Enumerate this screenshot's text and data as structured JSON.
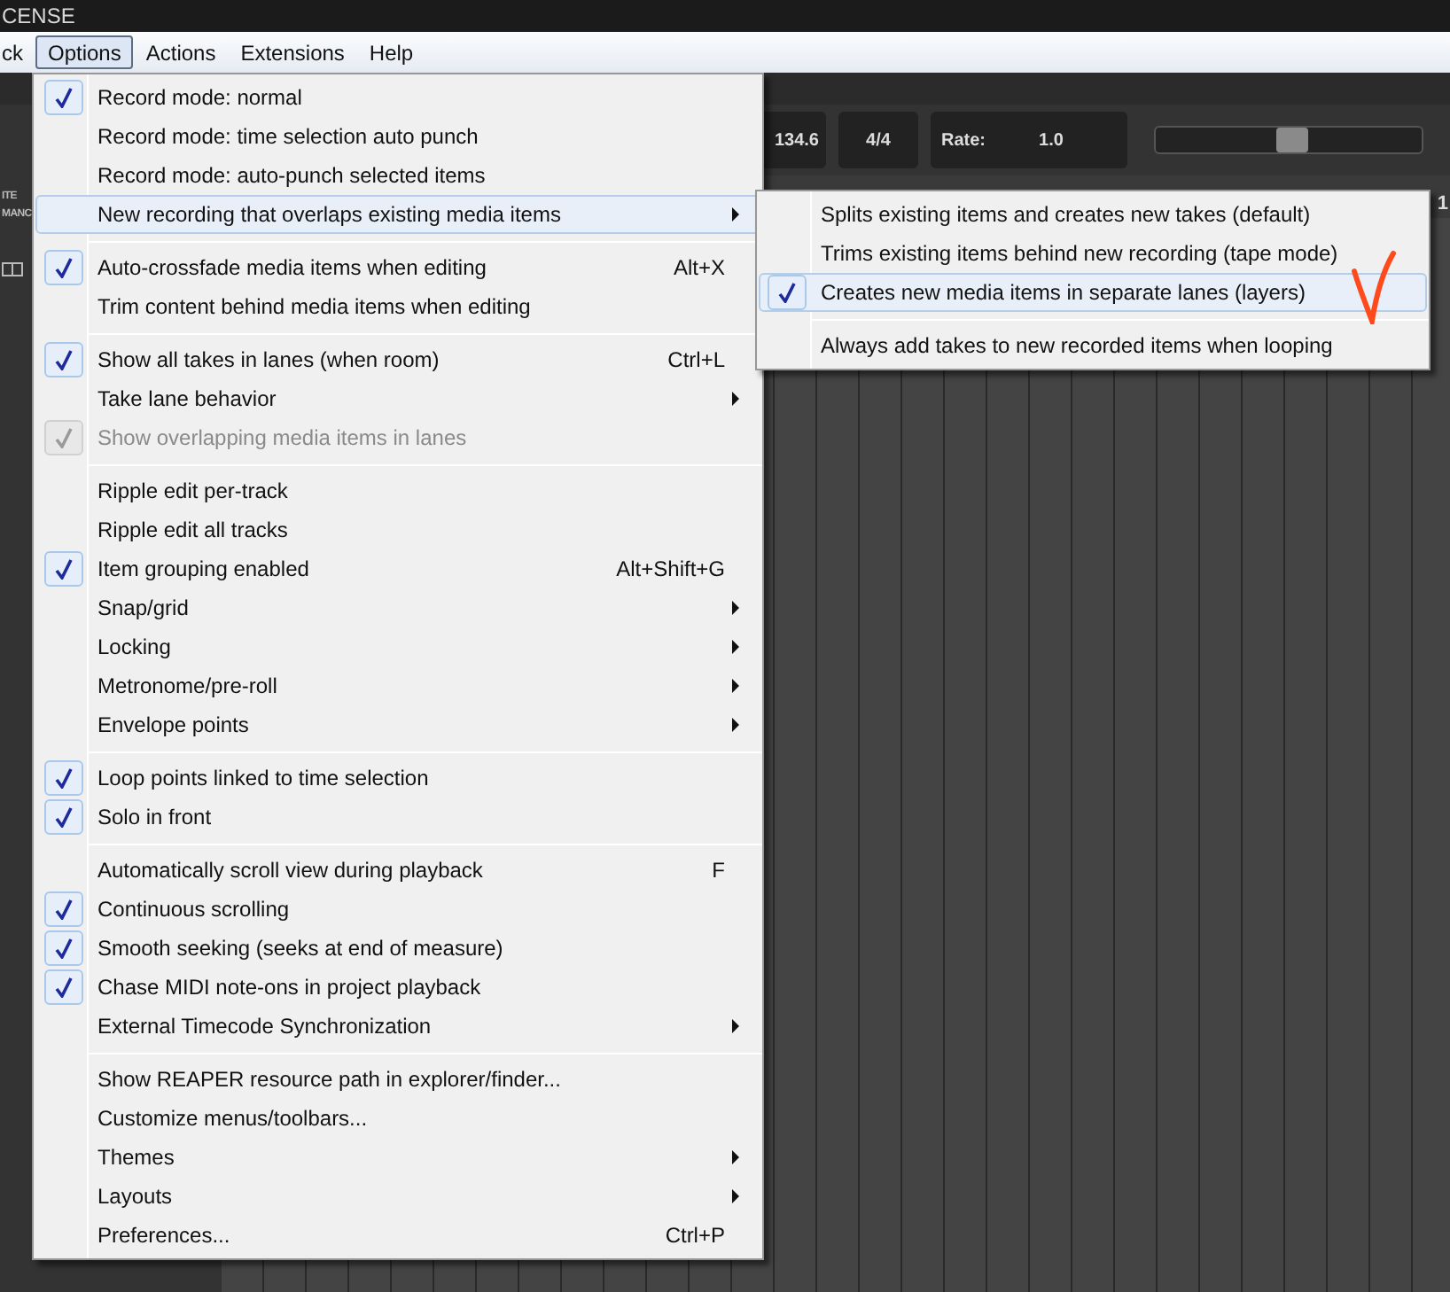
{
  "title_bar": {
    "title": "CENSE"
  },
  "menu_bar": [
    {
      "label": "ck",
      "selected": false
    },
    {
      "label": "Options",
      "selected": true
    },
    {
      "label": "Actions",
      "selected": false
    },
    {
      "label": "Extensions",
      "selected": false
    },
    {
      "label": "Help",
      "selected": false
    }
  ],
  "toolbar": {
    "tempo": "134.6",
    "time_signature": "4/4",
    "rate_label": "Rate:",
    "rate_value": "1.0",
    "playrate_slider": {
      "level": 0.51
    }
  },
  "track_panel": {
    "header_lines": [
      "ITE",
      "MANC"
    ]
  },
  "ruler": {
    "marker": "1"
  },
  "options_menu": [
    {
      "kind": "item",
      "label": "Record mode: normal",
      "checked": true,
      "disabled": false,
      "selected": false,
      "has_submenu": false
    },
    {
      "kind": "item",
      "label": "Record mode: time selection auto punch",
      "checked": false,
      "disabled": false,
      "selected": false,
      "has_submenu": false
    },
    {
      "kind": "item",
      "label": "Record mode: auto-punch selected items",
      "checked": false,
      "disabled": false,
      "selected": false,
      "has_submenu": false
    },
    {
      "kind": "item",
      "label": "New recording that overlaps existing media items",
      "checked": false,
      "disabled": false,
      "selected": true,
      "has_submenu": true
    },
    {
      "kind": "separator"
    },
    {
      "kind": "item",
      "label": "Auto-crossfade media items when editing",
      "checked": true,
      "disabled": false,
      "selected": false,
      "has_submenu": false,
      "shortcut": "Alt+X"
    },
    {
      "kind": "item",
      "label": "Trim content behind media items when editing",
      "checked": false,
      "disabled": false,
      "selected": false,
      "has_submenu": false
    },
    {
      "kind": "separator"
    },
    {
      "kind": "item",
      "label": "Show all takes in lanes (when room)",
      "checked": true,
      "disabled": false,
      "selected": false,
      "has_submenu": false,
      "shortcut": "Ctrl+L"
    },
    {
      "kind": "item",
      "label": "Take lane behavior",
      "checked": false,
      "disabled": false,
      "selected": false,
      "has_submenu": true
    },
    {
      "kind": "item",
      "label": "Show overlapping media items in lanes",
      "checked": true,
      "disabled": true,
      "selected": false,
      "has_submenu": false
    },
    {
      "kind": "separator"
    },
    {
      "kind": "item",
      "label": "Ripple edit per-track",
      "checked": false,
      "disabled": false,
      "selected": false,
      "has_submenu": false
    },
    {
      "kind": "item",
      "label": "Ripple edit all tracks",
      "checked": false,
      "disabled": false,
      "selected": false,
      "has_submenu": false
    },
    {
      "kind": "item",
      "label": "Item grouping enabled",
      "checked": true,
      "disabled": false,
      "selected": false,
      "has_submenu": false,
      "shortcut": "Alt+Shift+G"
    },
    {
      "kind": "item",
      "label": "Snap/grid",
      "checked": false,
      "disabled": false,
      "selected": false,
      "has_submenu": true
    },
    {
      "kind": "item",
      "label": "Locking",
      "checked": false,
      "disabled": false,
      "selected": false,
      "has_submenu": true
    },
    {
      "kind": "item",
      "label": "Metronome/pre-roll",
      "checked": false,
      "disabled": false,
      "selected": false,
      "has_submenu": true
    },
    {
      "kind": "item",
      "label": "Envelope points",
      "checked": false,
      "disabled": false,
      "selected": false,
      "has_submenu": true
    },
    {
      "kind": "separator"
    },
    {
      "kind": "item",
      "label": "Loop points linked to time selection",
      "checked": true,
      "disabled": false,
      "selected": false,
      "has_submenu": false
    },
    {
      "kind": "item",
      "label": "Solo in front",
      "checked": true,
      "disabled": false,
      "selected": false,
      "has_submenu": false
    },
    {
      "kind": "separator"
    },
    {
      "kind": "item",
      "label": "Automatically scroll view during playback",
      "checked": false,
      "disabled": false,
      "selected": false,
      "has_submenu": false,
      "shortcut": "F"
    },
    {
      "kind": "item",
      "label": "Continuous scrolling",
      "checked": true,
      "disabled": false,
      "selected": false,
      "has_submenu": false
    },
    {
      "kind": "item",
      "label": "Smooth seeking (seeks at end of measure)",
      "checked": true,
      "disabled": false,
      "selected": false,
      "has_submenu": false
    },
    {
      "kind": "item",
      "label": "Chase MIDI note-ons in project playback",
      "checked": true,
      "disabled": false,
      "selected": false,
      "has_submenu": false
    },
    {
      "kind": "item",
      "label": "External Timecode Synchronization",
      "checked": false,
      "disabled": false,
      "selected": false,
      "has_submenu": true
    },
    {
      "kind": "separator"
    },
    {
      "kind": "item",
      "label": "Show REAPER resource path in explorer/finder...",
      "checked": false,
      "disabled": false,
      "selected": false,
      "has_submenu": false
    },
    {
      "kind": "item",
      "label": "Customize menus/toolbars...",
      "checked": false,
      "disabled": false,
      "selected": false,
      "has_submenu": false
    },
    {
      "kind": "item",
      "label": "Themes",
      "checked": false,
      "disabled": false,
      "selected": false,
      "has_submenu": true
    },
    {
      "kind": "item",
      "label": "Layouts",
      "checked": false,
      "disabled": false,
      "selected": false,
      "has_submenu": true
    },
    {
      "kind": "item",
      "label": "Preferences...",
      "checked": false,
      "disabled": false,
      "selected": false,
      "has_submenu": false,
      "shortcut": "Ctrl+P"
    }
  ],
  "submenu": [
    {
      "kind": "item",
      "label": "Splits existing items and creates new takes (default)",
      "checked": false,
      "disabled": false,
      "selected": false,
      "has_submenu": false
    },
    {
      "kind": "item",
      "label": "Trims existing items behind new recording (tape mode)",
      "checked": false,
      "disabled": false,
      "selected": false,
      "has_submenu": false
    },
    {
      "kind": "item",
      "label": "Creates new media items in separate lanes (layers)",
      "checked": true,
      "disabled": false,
      "selected": true,
      "has_submenu": false
    },
    {
      "kind": "separator"
    },
    {
      "kind": "item",
      "label": "Always add takes to new recorded items when looping",
      "checked": false,
      "disabled": false,
      "selected": false,
      "has_submenu": false
    }
  ]
}
